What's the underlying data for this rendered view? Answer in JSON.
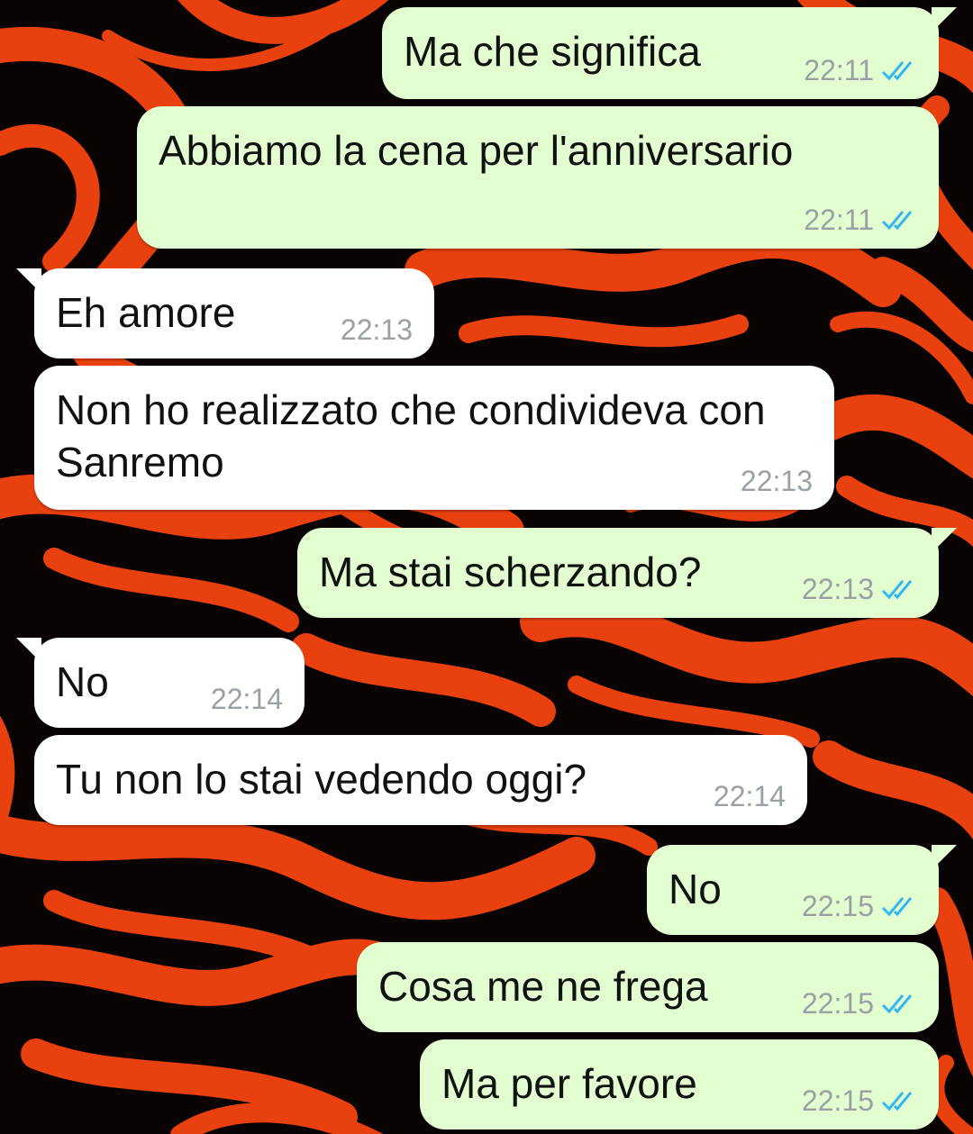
{
  "colors": {
    "outgoing_bubble": "#e2fdd0",
    "incoming_bubble": "#ffffff",
    "timestamp": "#9aa0a3",
    "read_ticks": "#34b7f1",
    "wallpaper_base": "#0a0303",
    "wallpaper_swirl": "#e8400f"
  },
  "messages": [
    {
      "direction": "outgoing",
      "text": "Ma che significa",
      "time": "22:11",
      "status_icon": "double-check-read-icon"
    },
    {
      "direction": "outgoing",
      "text": "Abbiamo la cena per l'anniversario",
      "time": "22:11",
      "status_icon": "double-check-read-icon"
    },
    {
      "direction": "incoming",
      "text": "Eh amore",
      "time": "22:13"
    },
    {
      "direction": "incoming",
      "text": "Non ho realizzato che condivideva con Sanremo",
      "time": "22:13"
    },
    {
      "direction": "outgoing",
      "text": "Ma stai scherzando?",
      "time": "22:13",
      "status_icon": "double-check-read-icon"
    },
    {
      "direction": "incoming",
      "text": "No",
      "time": "22:14"
    },
    {
      "direction": "incoming",
      "text": "Tu non lo stai vedendo oggi?",
      "time": "22:14"
    },
    {
      "direction": "outgoing",
      "text": "No",
      "time": "22:15",
      "status_icon": "double-check-read-icon"
    },
    {
      "direction": "outgoing",
      "text": "Cosa me ne frega",
      "time": "22:15",
      "status_icon": "double-check-read-icon"
    },
    {
      "direction": "outgoing",
      "text": "Ma per favore",
      "time": "22:15",
      "status_icon": "double-check-read-icon"
    }
  ]
}
